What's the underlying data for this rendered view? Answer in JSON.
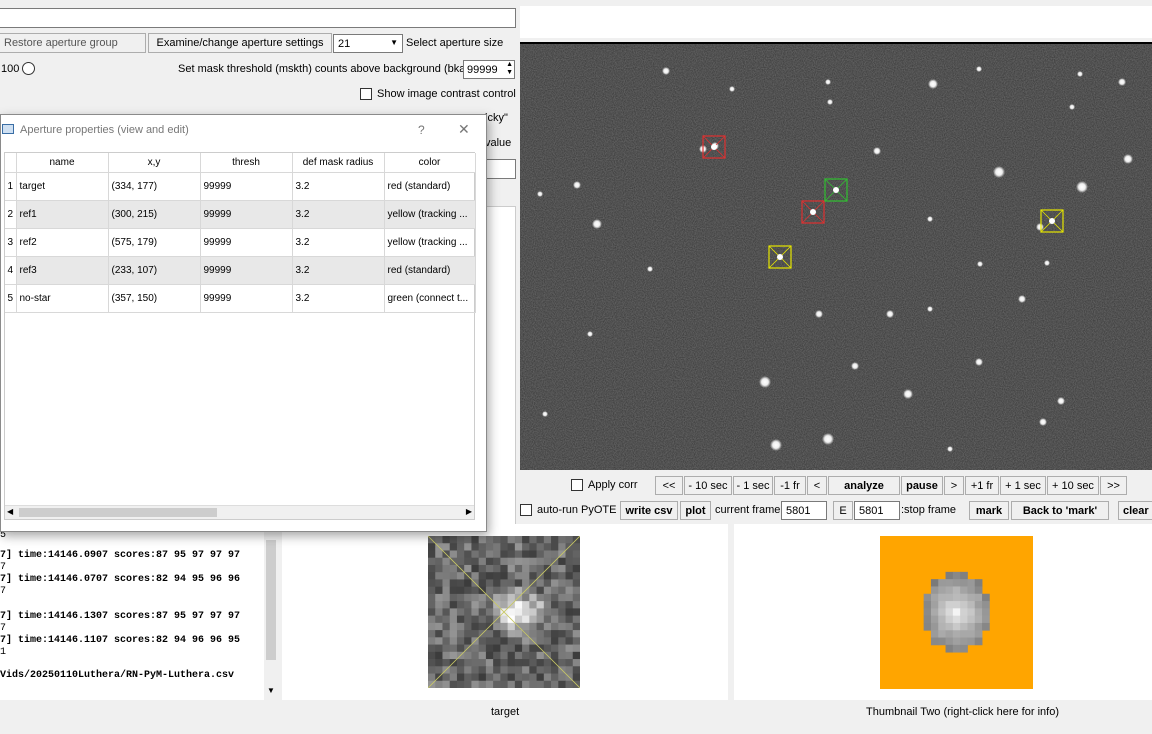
{
  "top": {
    "restore_group": "Restore aperture group",
    "examine_settings": "Examine/change aperture settings",
    "aperture_size": "21",
    "select_size_label": "Select aperture size",
    "radio_label": "100",
    "mask_threshold_label": "Set mask threshold (mskth) counts above background (bkavg)",
    "mask_threshold_value": "99999",
    "show_contrast": "Show image contrast control",
    "sticky_fragment": "icky\"",
    "value_fragment": "value"
  },
  "dialog": {
    "title": "Aperture properties (view and edit)",
    "help": "?",
    "close": "✕",
    "columns": [
      "name",
      "x,y",
      "thresh",
      "def mask radius",
      "color"
    ],
    "rows": [
      {
        "n": "1",
        "name": "target",
        "xy": "(334, 177)",
        "thresh": "99999",
        "radius": "3.2",
        "color": "red (standard)"
      },
      {
        "n": "2",
        "name": "ref1",
        "xy": "(300, 215)",
        "thresh": "99999",
        "radius": "3.2",
        "color": "yellow (tracking ..."
      },
      {
        "n": "3",
        "name": "ref2",
        "xy": "(575, 179)",
        "thresh": "99999",
        "radius": "3.2",
        "color": "yellow (tracking ..."
      },
      {
        "n": "4",
        "name": "ref3",
        "xy": "(233, 107)",
        "thresh": "99999",
        "radius": "3.2",
        "color": "red (standard)"
      },
      {
        "n": "5",
        "name": "no-star",
        "xy": "(357, 150)",
        "thresh": "99999",
        "radius": "3.2",
        "color": "green (connect t..."
      }
    ]
  },
  "controls": {
    "apply_corr": "Apply corr",
    "back_all": "<<",
    "minus10": "- 10 sec",
    "minus1": "- 1 sec",
    "minus1fr": "-1 fr",
    "prev": "<",
    "analyze": "analyze",
    "pause": "pause",
    "next": ">",
    "plus1fr": "+1 fr",
    "plus1": "+ 1 sec",
    "plus10": "+ 10 sec",
    "fwd_all": ">>",
    "auto_run": "auto-run PyOTE",
    "write_csv": "write csv",
    "plot": "plot",
    "current_frame_label": "current frame:",
    "current_frame": "5801",
    "e_btn": "E",
    "stop_frame": "5801",
    "stop_frame_label": ":stop frame",
    "mark": "mark",
    "back_to_mark": "Back to 'mark'",
    "clear": "clear c"
  },
  "log": {
    "lines": [
      "5",
      "7]   time:14146.0907  scores:87 95 97 97 97",
      "7",
      "7]   time:14146.0707  scores:82 94 95 96 96",
      "7",
      "7]   time:14146.1307  scores:87 95 97 97 97",
      "7",
      "7]   time:14146.1107  scores:82 94 96 96 95",
      "1",
      "Vids/20250110Luthera/RN-PyM-Luthera.csv"
    ]
  },
  "thumbnails": {
    "one_label": "target",
    "two_label": "Thumbnail Two (right-click here for info)"
  },
  "colors": {
    "thumb_two_bg": "#ffa500",
    "aperture_red": "#e03030",
    "aperture_yellow": "#e6e600",
    "aperture_green": "#30c030"
  }
}
